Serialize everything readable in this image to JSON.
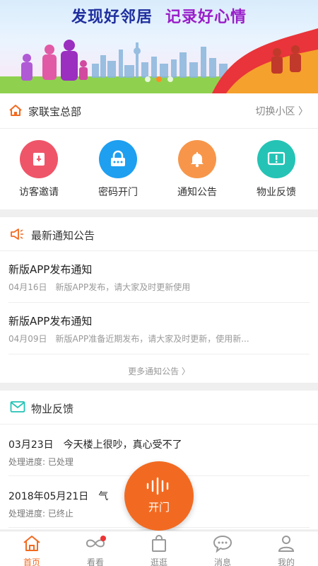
{
  "banner": {
    "slogan_left": "发现好邻居",
    "slogan_right": "记录好心情",
    "active_slide": 1,
    "slide_count": 3
  },
  "community": {
    "name": "家联宝总部",
    "switch_label": "切换小区 〉",
    "icon": "home-icon"
  },
  "actions": [
    {
      "label": "访客邀请",
      "icon": "visitor-invite-icon",
      "color": "#ef5568"
    },
    {
      "label": "密码开门",
      "icon": "password-lock-icon",
      "color": "#1e9ff0"
    },
    {
      "label": "通知公告",
      "icon": "bell-icon",
      "color": "#f7964a"
    },
    {
      "label": "物业反馈",
      "icon": "feedback-message-icon",
      "color": "#24c3b5"
    }
  ],
  "notices": {
    "title": "最新通知公告",
    "icon": "megaphone-icon",
    "items": [
      {
        "title": "新版APP发布通知",
        "date": "04月16日",
        "summary": "新版APP发布，请大家及时更新使用"
      },
      {
        "title": "新版APP发布通知",
        "date": "04月09日",
        "summary": "新版APP准备近期发布，请大家及时更新，使用新..."
      }
    ],
    "more_label": "更多通知公告 〉"
  },
  "feedback": {
    "title": "物业反馈",
    "icon": "mail-icon",
    "items": [
      {
        "date": "03月23日",
        "content": "今天楼上很吵，真心受不了",
        "status": "处理进度: 已处理"
      },
      {
        "date": "2018年05月21日",
        "content": "气",
        "status": "处理进度: 已终止"
      }
    ]
  },
  "open_door": {
    "label": "开门",
    "icon": "sound-wave-icon"
  },
  "tabs": [
    {
      "label": "首页",
      "icon": "home-tab-icon",
      "active": true
    },
    {
      "label": "看看",
      "icon": "infinity-icon",
      "badge": true
    },
    {
      "label": "逛逛",
      "icon": "shopping-bag-icon"
    },
    {
      "label": "消息",
      "icon": "chat-bubble-icon"
    },
    {
      "label": "我的",
      "icon": "user-icon"
    }
  ],
  "colors": {
    "accent": "#f26a21",
    "inactive_tab": "#888888"
  }
}
